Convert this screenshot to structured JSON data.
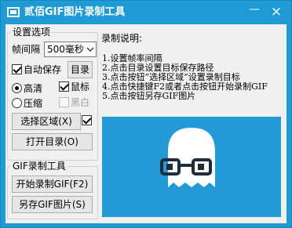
{
  "window": {
    "title": "贰佰GIF图片录制工具",
    "minimize_label": "—",
    "close_label": "×"
  },
  "settings": {
    "group_title": "设置选项",
    "interval_label": "帧间隔",
    "interval_value": "500毫秒",
    "auto_save_label": "自动保存",
    "auto_save_checked": true,
    "directory_button": "目录",
    "quality_high_label": "高清",
    "quality_high_selected": true,
    "quality_compress_label": "压缩",
    "quality_compress_selected": false,
    "cursor_label": "鼠标",
    "cursor_checked": true,
    "grayscale_label": "黑白",
    "grayscale_checked": false,
    "select_area_button": "选择区域(X)",
    "select_area_checked": true,
    "open_dir_button": "打开目录(O)"
  },
  "recorder": {
    "group_title": "GIF录制工具",
    "start_button": "开始录制GIF(F2)",
    "save_button": "另存GIF图片(S)"
  },
  "instructions": {
    "title": "录制说明:",
    "items": [
      "1.设置帧率间隔",
      "2.点击目录设置目标保存路径",
      "3.点击按钮“选择区域”设置录制目标",
      "4.点击快捷键F2或者点击按钮开始录制GIF",
      "5.点击按钮另存GIF图片"
    ]
  },
  "colors": {
    "titlebar": "#1e9bd5",
    "preview_bg": "#239ad6",
    "ghost": "#ffffff",
    "glasses": "#1f2d3a"
  }
}
